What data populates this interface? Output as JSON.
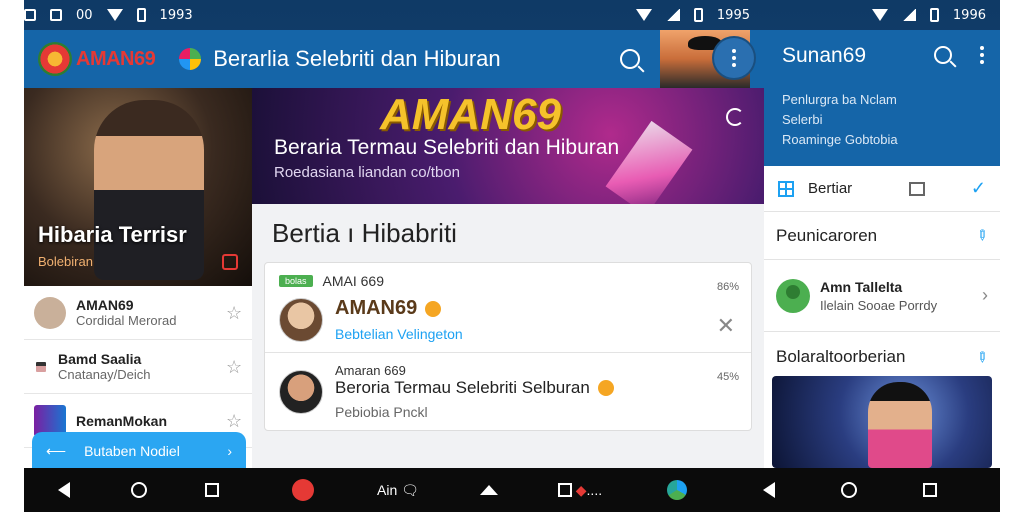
{
  "status_left": {
    "icons": [
      "chat-icon",
      "image-icon",
      "voicemail-icon"
    ],
    "text_left": "00",
    "time": "1993",
    "right_time": "1995"
  },
  "status_right": {
    "time": "1996"
  },
  "appbar": {
    "brand": "AMAN69",
    "title": "Berarlia Selebriti dan Hiburan"
  },
  "left": {
    "hero": {
      "title": "Hibaria Terrisr",
      "subtitle": "Bolebiran"
    },
    "contacts": [
      {
        "name": "AMAN69",
        "sub": "Cordidal Merorad"
      },
      {
        "name": "Bamd Saalia",
        "sub": "Cnatanay/Deich"
      },
      {
        "name": "RemanMokan",
        "sub": ""
      }
    ],
    "pill": {
      "label": "Butaben Nodiel"
    }
  },
  "center": {
    "banner": {
      "logo": "AMAN69",
      "title": "Beraria Termau Selebriti dan Hiburan",
      "subtitle": "Roedasiana liandan co/tbon"
    },
    "section_title": "Bertia ı Hibabriti",
    "posts": [
      {
        "tag": "bolas",
        "top": "AMAI 669",
        "pct": "86%",
        "title": "AMAN69",
        "link": "Bebtelian Velingeton"
      },
      {
        "top": "Amaran 669",
        "pct": "45%",
        "line": "Beroria Termau Selebriti Selburan",
        "foot": "Pebiobia Pnckl"
      }
    ]
  },
  "right": {
    "title": "Sunan69",
    "lines": [
      "Penlurgra ba Nclam",
      "Selerbi",
      "Roaminge Gobtobia"
    ],
    "tab_label": "Bertiar",
    "section1": "Peunicaroren",
    "user": {
      "name": "Amn Tallelta",
      "sub": "Ilelain Sooae Porrdy"
    },
    "section2": "Bolaraltoorberian"
  },
  "navbar": {
    "center_text": "Ain",
    "dots_text": "...."
  },
  "colors": {
    "appbar": "#1565a8",
    "accent": "#1da1f2",
    "brand_red": "#e53935",
    "banner_gold": "#f5c22b"
  }
}
